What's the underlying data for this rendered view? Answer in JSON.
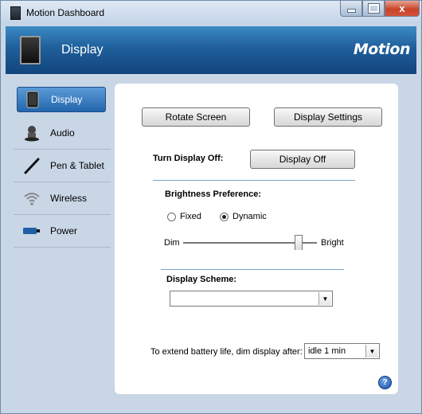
{
  "window": {
    "title": "Motion Dashboard",
    "close_glyph": "x"
  },
  "header": {
    "title": "Display",
    "logo": "Motion"
  },
  "sidebar": {
    "items": [
      {
        "label": "Display",
        "icon": "tablet-icon",
        "active": true
      },
      {
        "label": "Audio",
        "icon": "audio-icon"
      },
      {
        "label": "Pen & Tablet",
        "icon": "pen-icon"
      },
      {
        "label": "Wireless",
        "icon": "wireless-icon"
      },
      {
        "label": "Power",
        "icon": "battery-icon"
      }
    ]
  },
  "main": {
    "rotate_button": "Rotate Screen",
    "settings_button": "Display Settings",
    "turn_off_label": "Turn Display Off:",
    "display_off_button": "Display Off",
    "brightness_label": "Brightness Preference:",
    "radio_fixed": "Fixed",
    "radio_dynamic": "Dynamic",
    "dynamic_selected": true,
    "slider_min_label": "Dim",
    "slider_max_label": "Bright",
    "slider_value_fraction": 0.86,
    "scheme_label": "Display Scheme:",
    "scheme_value": "",
    "battery_label": "To extend battery life, dim display after:",
    "dim_after_value": "idle 1 min",
    "help_glyph": "?"
  },
  "colors": {
    "header": "#1f5f9b",
    "accent": "#2466ad",
    "frame": "#c9d6e6"
  }
}
